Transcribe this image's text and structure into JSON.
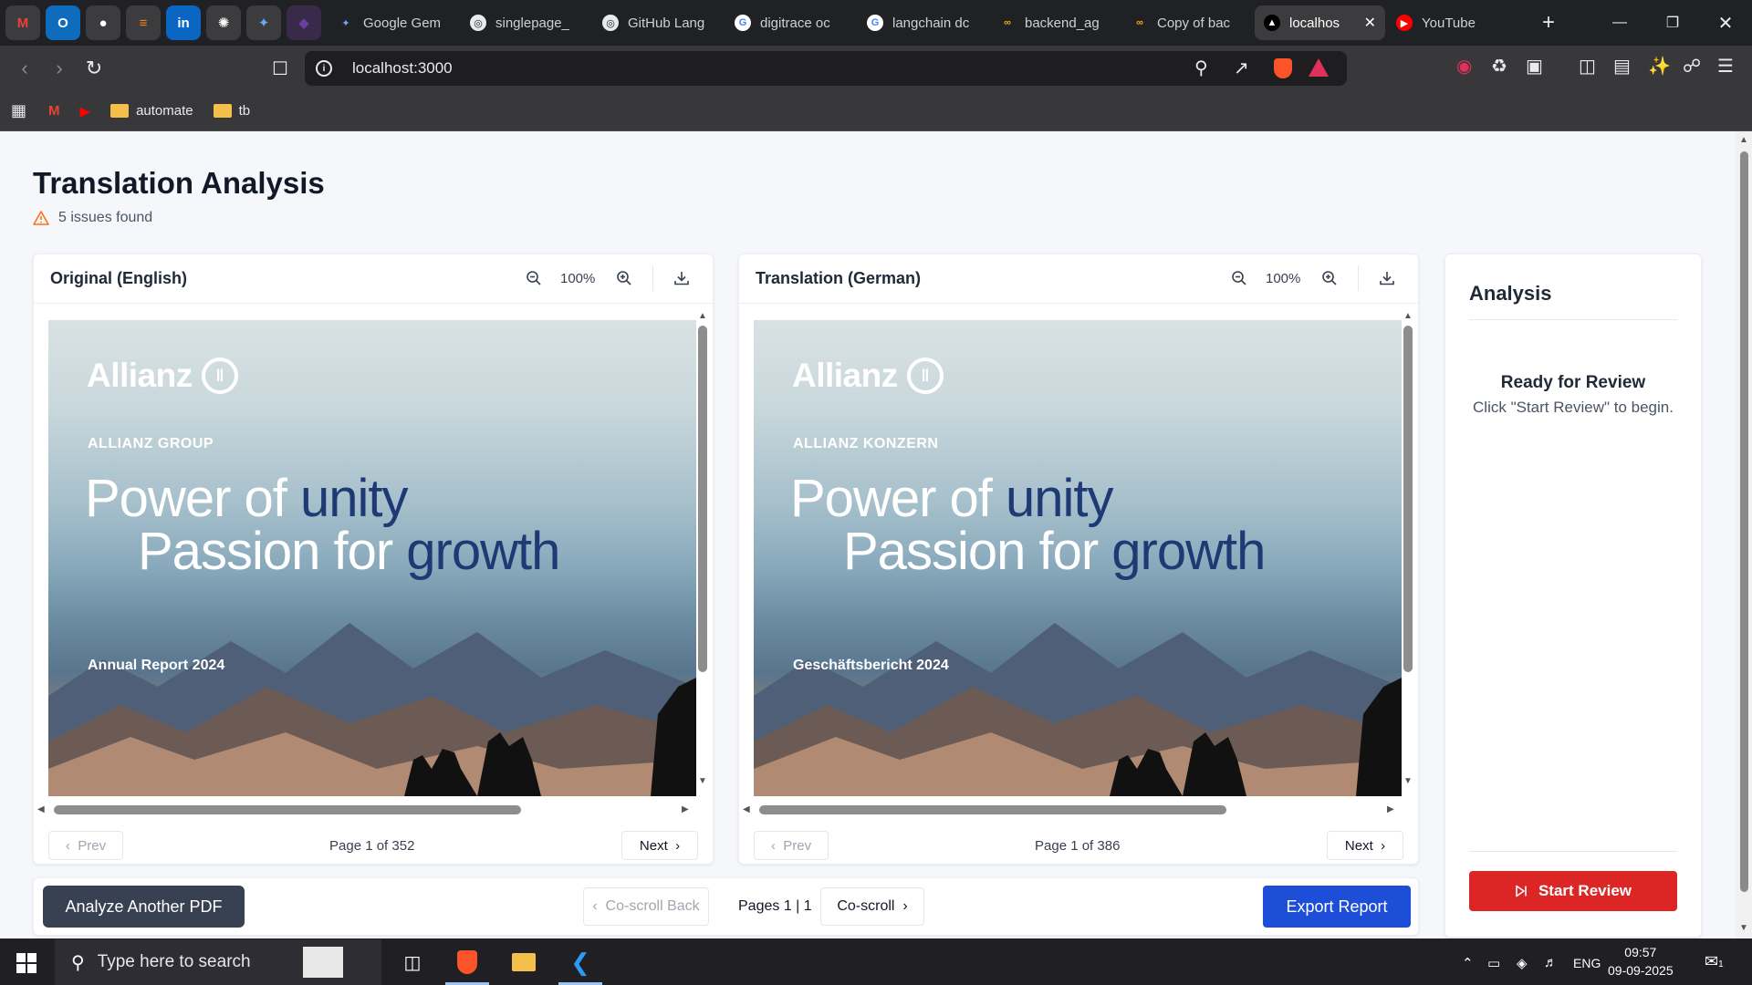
{
  "browser": {
    "pinned_tabs": [
      {
        "name": "gmail-icon",
        "glyph": "M",
        "color": "#3c3c3e",
        "fg": "#ea4335"
      },
      {
        "name": "outlook-icon",
        "glyph": "O",
        "color": "#0f6cbd",
        "fg": "#ffffff"
      },
      {
        "name": "github-icon",
        "glyph": "●",
        "color": "#3c3c3e",
        "fg": "#ffffff"
      },
      {
        "name": "stackoverflow-icon",
        "glyph": "≡",
        "color": "#3c3c3e",
        "fg": "#f48024"
      },
      {
        "name": "linkedin-icon",
        "glyph": "in",
        "color": "#0a66c2",
        "fg": "#ffffff"
      },
      {
        "name": "chatgpt-icon",
        "glyph": "✺",
        "color": "#3c3c3e",
        "fg": "#ffffff"
      },
      {
        "name": "gemini-icon",
        "glyph": "✦",
        "color": "#3c3c3e",
        "fg": "#6aa8ff"
      },
      {
        "name": "app-icon",
        "glyph": "◆",
        "color": "#3a2a4a",
        "fg": "#6b3fa0"
      }
    ],
    "tabs": [
      {
        "title": "Google Gem",
        "fav": "✦",
        "favbg": "transparent",
        "favfg": "#6aa8ff"
      },
      {
        "title": "singlepage_",
        "fav": "◎",
        "favbg": "#e8eaed",
        "favfg": "#202124"
      },
      {
        "title": "GitHub Lang",
        "fav": "◎",
        "favbg": "#e8eaed",
        "favfg": "#202124"
      },
      {
        "title": "digitrace oc",
        "fav": "G",
        "favbg": "#ffffff",
        "favfg": "#4285f4"
      },
      {
        "title": "langchain dc",
        "fav": "G",
        "favbg": "#ffffff",
        "favfg": "#4285f4"
      },
      {
        "title": "backend_ag",
        "fav": "∞",
        "favbg": "transparent",
        "favfg": "#f9ab00"
      },
      {
        "title": "Copy of bac",
        "fav": "∞",
        "favbg": "transparent",
        "favfg": "#f9ab00"
      },
      {
        "title": "localhos",
        "fav": "▲",
        "favbg": "#000000",
        "favfg": "#ffffff",
        "active": true
      },
      {
        "title": "YouTube",
        "fav": "▶",
        "favbg": "#ff0000",
        "favfg": "#ffffff"
      }
    ],
    "url": "localhost:3000",
    "bookmarks": [
      {
        "label": "automate"
      },
      {
        "label": "tb"
      }
    ]
  },
  "app": {
    "title": "Translation Analysis",
    "issues": "5 issues found",
    "left": {
      "title": "Original (English)",
      "zoom": "100%",
      "doc": {
        "group": "ALLIANZ GROUP",
        "line1a": "Power of ",
        "line1b": "unity",
        "line2a": "Passion for ",
        "line2b": "growth",
        "report": "Annual Report 2024",
        "logo": "Allianz"
      },
      "prev": "Prev",
      "next": "Next",
      "page_info": "Page 1 of 352"
    },
    "right": {
      "title": "Translation (German)",
      "zoom": "100%",
      "doc": {
        "group": "ALLIANZ KONZERN",
        "line1a": "Power of ",
        "line1b": "unity",
        "line2a": "Passion for ",
        "line2b": "growth",
        "report": "Geschäftsbericht 2024",
        "logo": "Allianz"
      },
      "prev": "Prev",
      "next": "Next",
      "page_info": "Page 1 of 386"
    },
    "analysis": {
      "title": "Analysis",
      "ready": "Ready for Review",
      "ready_sub": "Click \"Start Review\" to begin.",
      "start": "Start Review"
    },
    "bottom": {
      "analyze_another": "Analyze Another PDF",
      "coscroll_back": "Co-scroll Back",
      "pages": "Pages 1 | 1",
      "coscroll": "Co-scroll",
      "export": "Export Report"
    }
  },
  "taskbar": {
    "search_placeholder": "Type here to search",
    "lang": "ENG",
    "time": "09:57",
    "date": "09-09-2025",
    "notif_count": "1"
  }
}
